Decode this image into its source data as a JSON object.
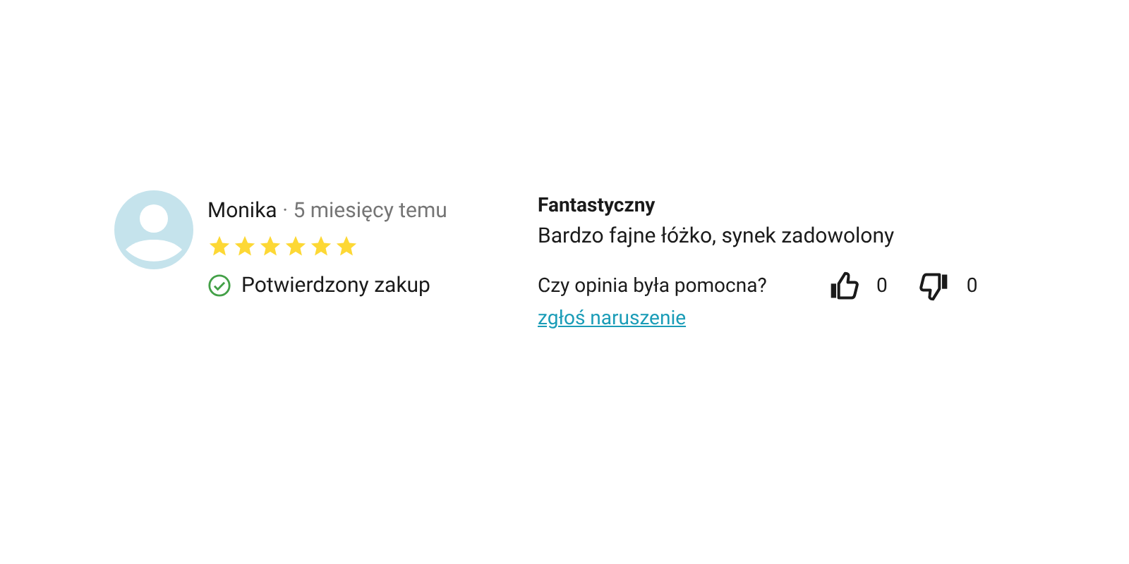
{
  "review": {
    "author": "Monika",
    "separator": "·",
    "time": "5 miesięcy temu",
    "stars": 6,
    "badge": "Potwierdzony zakup",
    "title": "Fantastyczny",
    "body": "Bardzo fajne łóżko, synek zadowolony",
    "helpful_question": "Czy opinia była pomocna?",
    "likes": "0",
    "dislikes": "0",
    "report_link": "zgłoś naruszenie"
  }
}
